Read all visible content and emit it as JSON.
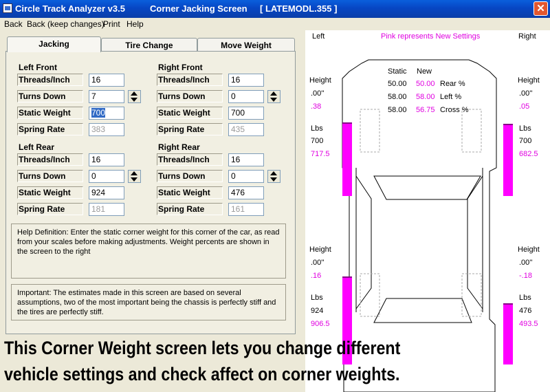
{
  "titlebar": {
    "app_name": "Circle Track Analyzer v3.5",
    "screen": "Corner Jacking Screen",
    "file": "[ LATEMODL.355 ]",
    "close_glyph": "✕"
  },
  "menu": {
    "back": "Back",
    "back_keep": "Back (keep changes)",
    "print": "Print",
    "help": "Help"
  },
  "tabs": {
    "jacking": "Jacking",
    "tire_change": "Tire Change",
    "move_weight": "Move Weight"
  },
  "labels": {
    "threads": "Threads/Inch",
    "turns": "Turns Down",
    "static": "Static Weight",
    "spring": "Spring Rate"
  },
  "left_front": {
    "title": "Left Front",
    "threads": "16",
    "turns": "7",
    "static": "700",
    "spring": "383"
  },
  "right_front": {
    "title": "Right Front",
    "threads": "16",
    "turns": "0",
    "static": "700",
    "spring": "435"
  },
  "left_rear": {
    "title": "Left Rear",
    "threads": "16",
    "turns": "0",
    "static": "924",
    "spring": "181"
  },
  "right_rear": {
    "title": "Right Rear",
    "threads": "16",
    "turns": "0",
    "static": "476",
    "spring": "161"
  },
  "help_text": "Help Definition:  Enter the static corner weight for this corner of the car, as read from your scales before making adjustments.  Weight percents are shown in the screen to the right",
  "important_text": "Important:  The estimates made in this screen are based on several assumptions, two of the most important being the chassis is perfectly stiff and the tires are perfectly stiff.",
  "right_panel": {
    "left_label": "Left",
    "right_label": "Right",
    "legend": "Pink represents New Settings",
    "col_static": "Static",
    "col_new": "New",
    "rows": [
      {
        "static": "50.00",
        "new": "50.00",
        "name": "Rear %"
      },
      {
        "static": "58.00",
        "new": "58.00",
        "name": "Left %"
      },
      {
        "static": "58.00",
        "new": "56.75",
        "name": "Cross %"
      }
    ],
    "height_label": "Height",
    "lbs_label": "Lbs",
    "lf": {
      "height": ".00''",
      "height_new": ".38",
      "lbs": "700",
      "lbs_new": "717.5"
    },
    "rf": {
      "height": ".00''",
      "height_new": ".05",
      "lbs": "700",
      "lbs_new": "682.5"
    },
    "lr": {
      "height": ".00''",
      "height_new": ".16",
      "lbs": "924",
      "lbs_new": "906.5"
    },
    "rr": {
      "height": ".00''",
      "height_new": "-.18",
      "lbs": "476",
      "lbs_new": "493.5"
    }
  },
  "caption": {
    "line1": "This Corner Weight screen lets you change different",
    "line2": "vehicle settings and check affect on corner weights."
  },
  "colors": {
    "pink": "#ff00ff",
    "title_blue": "#0a5fdc"
  }
}
